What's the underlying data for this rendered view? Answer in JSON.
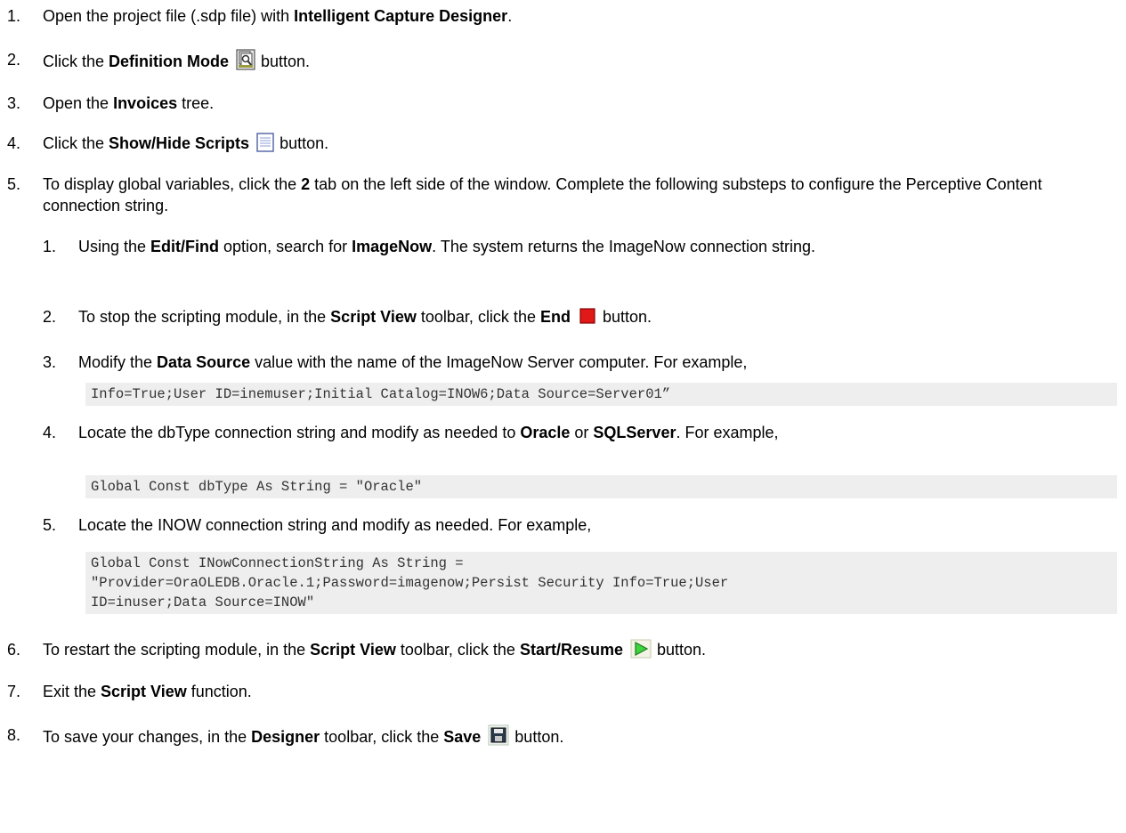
{
  "steps": [
    {
      "num": "1.",
      "parts": [
        "Open the project file (.sdp file) with ",
        "Intelligent Capture Designer",
        "."
      ]
    },
    {
      "num": "2.",
      "parts": [
        "Click the ",
        "Definition Mode",
        "button."
      ]
    },
    {
      "num": "3.",
      "parts": [
        "Open the ",
        "Invoices",
        " tree."
      ]
    },
    {
      "num": "4.",
      "parts": [
        "Click the ",
        "Show/Hide Scripts",
        "button."
      ]
    },
    {
      "num": "5.",
      "parts": [
        "To display global variables, click the ",
        "2",
        " tab on the left side of the window. Complete the following substeps to configure the Perceptive Content connection string."
      ]
    },
    {
      "num": "6.",
      "parts": [
        "To restart the scripting module, in the ",
        "Script View",
        " toolbar, click the ",
        "Start/Resume",
        "button."
      ]
    },
    {
      "num": "7.",
      "parts": [
        "Exit the ",
        "Script View",
        " function."
      ]
    },
    {
      "num": "8.",
      "parts": [
        "To save your changes, in the ",
        "Designer",
        " toolbar, click the ",
        "Save",
        "button."
      ]
    }
  ],
  "substeps": [
    {
      "num": "1.",
      "parts": [
        "Using the ",
        "Edit/Find",
        " option, search for ",
        "ImageNow",
        ". The system returns the ImageNow connection string."
      ]
    },
    {
      "num": "2.",
      "parts": [
        "To stop the scripting module, in the ",
        "Script View",
        " toolbar, click the ",
        "End",
        "button."
      ]
    },
    {
      "num": "3.",
      "parts": [
        "Modify the ",
        "Data Source",
        " value with the name of the ImageNow Server computer. For example,"
      ]
    },
    {
      "num": "4.",
      "parts": [
        "Locate the dbType connection string and modify as needed to ",
        "Oracle",
        " or ",
        "SQLServer",
        ". For example,"
      ]
    },
    {
      "num": "5.",
      "parts": [
        "Locate the INOW connection string and modify as needed. For example,"
      ]
    }
  ],
  "code": [
    "Info=True;User ID=inemuser;Initial Catalog=INOW6;Data Source=Server01”",
    "Global Const dbType As String = \"Oracle\"",
    "Global Const INowConnectionString As String =\n\"Provider=OraOLEDB.Oracle.1;Password=imagenow;Persist Security Info=True;User\nID=inuser;Data Source=INOW\""
  ],
  "icons": [
    "definition-mode-icon",
    "show-hide-scripts-icon",
    "end-icon",
    "start-resume-icon",
    "save-icon"
  ]
}
